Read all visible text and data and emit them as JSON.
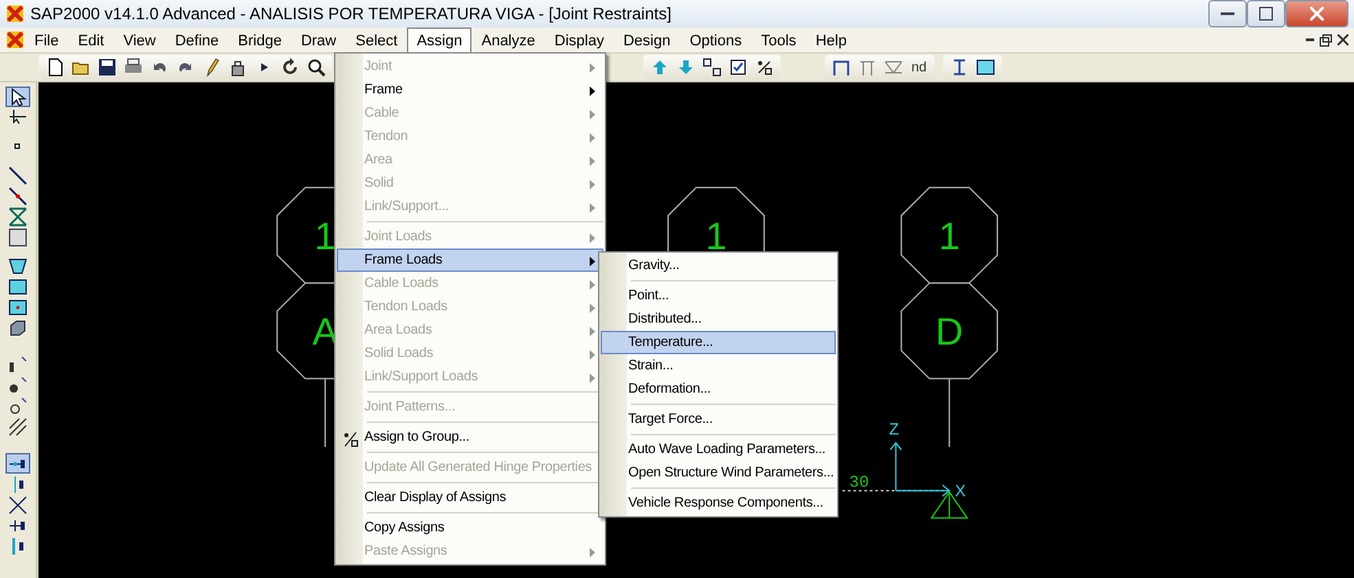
{
  "window": {
    "title": "SAP2000 v14.1.0 Advanced  - ANALISIS POR TEMPERATURA VIGA - [Joint Restraints]"
  },
  "menubar": [
    {
      "label": "File",
      "selected": false
    },
    {
      "label": "Edit",
      "selected": false
    },
    {
      "label": "View",
      "selected": false
    },
    {
      "label": "Define",
      "selected": false
    },
    {
      "label": "Bridge",
      "selected": false
    },
    {
      "label": "Draw",
      "selected": false
    },
    {
      "label": "Select",
      "selected": false
    },
    {
      "label": "Assign",
      "selected": true
    },
    {
      "label": "Analyze",
      "selected": false
    },
    {
      "label": "Display",
      "selected": false
    },
    {
      "label": "Design",
      "selected": false
    },
    {
      "label": "Options",
      "selected": false
    },
    {
      "label": "Tools",
      "selected": false
    },
    {
      "label": "Help",
      "selected": false
    }
  ],
  "toolbar": {
    "text_button": "nd"
  },
  "left_toolbar": [
    {
      "selected": true
    },
    {
      "selected": false
    },
    {
      "selected": false
    },
    {
      "selected": false
    },
    {
      "selected": false
    },
    {
      "selected": false
    },
    {
      "selected": false
    },
    {
      "selected": false
    },
    {
      "selected": false
    },
    {
      "selected": false
    },
    {
      "selected": false
    },
    {
      "selected": false
    },
    {
      "selected": false
    },
    {
      "selected": false
    },
    {
      "selected": false
    },
    {
      "selected": true
    },
    {
      "selected": false
    },
    {
      "selected": false
    },
    {
      "selected": false
    },
    {
      "selected": false
    }
  ],
  "canvas": {
    "joint_labels": [
      "1",
      "A",
      "1",
      "1",
      "D"
    ],
    "dimension_text": "30",
    "axis_labels": [
      "Z",
      "X"
    ]
  },
  "assign_menu": [
    {
      "kind": "item",
      "label": "Joint",
      "disabled": true,
      "submenu": true,
      "selected": false,
      "icon": false
    },
    {
      "kind": "item",
      "label": "Frame",
      "disabled": false,
      "submenu": true,
      "selected": false,
      "icon": false
    },
    {
      "kind": "item",
      "label": "Cable",
      "disabled": true,
      "submenu": true,
      "selected": false,
      "icon": false
    },
    {
      "kind": "item",
      "label": "Tendon",
      "disabled": true,
      "submenu": true,
      "selected": false,
      "icon": false
    },
    {
      "kind": "item",
      "label": "Area",
      "disabled": true,
      "submenu": true,
      "selected": false,
      "icon": false
    },
    {
      "kind": "item",
      "label": "Solid",
      "disabled": true,
      "submenu": true,
      "selected": false,
      "icon": false
    },
    {
      "kind": "item",
      "label": "Link/Support...",
      "disabled": true,
      "submenu": true,
      "selected": false,
      "icon": false
    },
    {
      "kind": "separator"
    },
    {
      "kind": "item",
      "label": "Joint Loads",
      "disabled": true,
      "submenu": true,
      "selected": false,
      "icon": false
    },
    {
      "kind": "item",
      "label": "Frame Loads",
      "disabled": false,
      "submenu": true,
      "selected": true,
      "icon": false
    },
    {
      "kind": "item",
      "label": "Cable Loads",
      "disabled": true,
      "submenu": true,
      "selected": false,
      "icon": false
    },
    {
      "kind": "item",
      "label": "Tendon Loads",
      "disabled": true,
      "submenu": true,
      "selected": false,
      "icon": false
    },
    {
      "kind": "item",
      "label": "Area Loads",
      "disabled": true,
      "submenu": true,
      "selected": false,
      "icon": false
    },
    {
      "kind": "item",
      "label": "Solid Loads",
      "disabled": true,
      "submenu": true,
      "selected": false,
      "icon": false
    },
    {
      "kind": "item",
      "label": "Link/Support Loads",
      "disabled": true,
      "submenu": true,
      "selected": false,
      "icon": false
    },
    {
      "kind": "separator"
    },
    {
      "kind": "item",
      "label": "Joint Patterns...",
      "disabled": true,
      "submenu": false,
      "selected": false,
      "icon": false
    },
    {
      "kind": "separator"
    },
    {
      "kind": "item",
      "label": "Assign to Group...",
      "disabled": false,
      "submenu": false,
      "selected": false,
      "icon": true
    },
    {
      "kind": "separator"
    },
    {
      "kind": "item",
      "label": "Update All Generated Hinge Properties",
      "disabled": true,
      "submenu": false,
      "selected": false,
      "icon": false
    },
    {
      "kind": "separator"
    },
    {
      "kind": "item",
      "label": "Clear Display of Assigns",
      "disabled": false,
      "submenu": false,
      "selected": false,
      "icon": false
    },
    {
      "kind": "separator"
    },
    {
      "kind": "item",
      "label": "Copy Assigns",
      "disabled": false,
      "submenu": false,
      "selected": false,
      "icon": false
    },
    {
      "kind": "item",
      "label": "Paste Assigns",
      "disabled": true,
      "submenu": true,
      "selected": false,
      "icon": false
    }
  ],
  "frame_loads_menu": [
    {
      "kind": "item",
      "label": "Gravity...",
      "selected": false
    },
    {
      "kind": "separator"
    },
    {
      "kind": "item",
      "label": "Point...",
      "selected": false
    },
    {
      "kind": "item",
      "label": "Distributed...",
      "selected": false
    },
    {
      "kind": "item",
      "label": "Temperature...",
      "selected": true
    },
    {
      "kind": "item",
      "label": "Strain...",
      "selected": false
    },
    {
      "kind": "item",
      "label": "Deformation...",
      "selected": false
    },
    {
      "kind": "separator"
    },
    {
      "kind": "item",
      "label": "Target Force...",
      "selected": false
    },
    {
      "kind": "separator"
    },
    {
      "kind": "item",
      "label": "Auto Wave Loading Parameters...",
      "selected": false
    },
    {
      "kind": "item",
      "label": "Open Structure Wind Parameters...",
      "selected": false
    },
    {
      "kind": "separator"
    },
    {
      "kind": "item",
      "label": "Vehicle Response Components...",
      "selected": false
    }
  ]
}
